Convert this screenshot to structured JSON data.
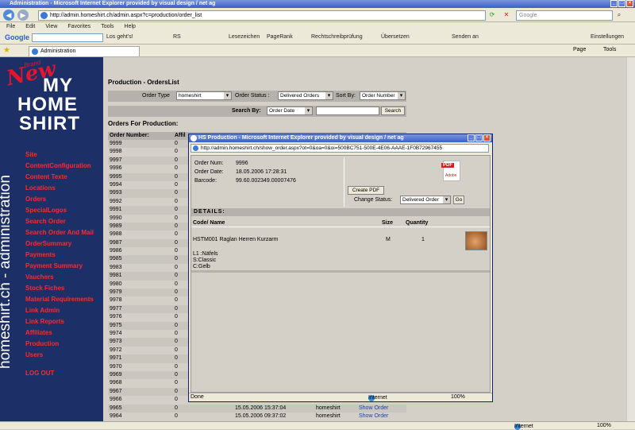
{
  "window": {
    "title": "Administration - Microsoft Internet Explorer provided by visual design / net ag",
    "address": "http://admin.homeshirt.ch/admin.aspx?c=production/order_list",
    "search_placeholder": "Google"
  },
  "menu": [
    "File",
    "Edit",
    "View",
    "Favorites",
    "Tools",
    "Help"
  ],
  "googlebar": {
    "logo": "Google",
    "items": [
      "Los geht's!",
      "RS",
      "Lesezeichen",
      "PageRank",
      "Rechtschreibprüfung",
      "Übersetzen",
      "Senden an",
      "Einstellungen"
    ]
  },
  "tabs": {
    "active": "Administration",
    "right_items": [
      "Page",
      "Tools"
    ]
  },
  "sidebar": {
    "logo_brand": "Brand",
    "logo_new": "New",
    "logo_my": "MY",
    "logo_home": "HOME",
    "logo_shirt": "SHIRT",
    "vertical": "homeshirt.ch - administration",
    "items": [
      "Site",
      "ContentConfiguration",
      "Content Texte",
      "Locations",
      "Orders",
      "SpecialLogos",
      "Search Order",
      "Search Order And Mail",
      "OrderSummary",
      "Payments",
      "Payment Summary",
      "Vauchers",
      "Stock Fiches",
      "Material Requirements",
      "Link Admin",
      "Link Reports",
      "Affiliates",
      "Production",
      "Users"
    ],
    "logout": "LOG OUT"
  },
  "page": {
    "title": "Production - OrdersList",
    "order_type_label": "Order Type",
    "order_type_value": "homeshirt",
    "order_status_label": "Order Status :",
    "order_status_value": "Delivered Orders",
    "sort_by_label": "Sort By:",
    "sort_by_value": "Order Number",
    "search_by_label": "Search By:",
    "search_by_value": "Order Date",
    "search_button": "Search",
    "orders_heading": "Orders For Production:",
    "col_order_number": "Order Number:",
    "col_affi": "Affil",
    "orders": [
      {
        "num": "9999",
        "affi": "0"
      },
      {
        "num": "9998",
        "affi": "0"
      },
      {
        "num": "9997",
        "affi": "0"
      },
      {
        "num": "9996",
        "affi": "0"
      },
      {
        "num": "9995",
        "affi": "0"
      },
      {
        "num": "9994",
        "affi": "0"
      },
      {
        "num": "9993",
        "affi": "0"
      },
      {
        "num": "9992",
        "affi": "0"
      },
      {
        "num": "9991",
        "affi": "0"
      },
      {
        "num": "9990",
        "affi": "0"
      },
      {
        "num": "9989",
        "affi": "0"
      },
      {
        "num": "9988",
        "affi": "0"
      },
      {
        "num": "9987",
        "affi": "0"
      },
      {
        "num": "9986",
        "affi": "0"
      },
      {
        "num": "9985",
        "affi": "0"
      },
      {
        "num": "9983",
        "affi": "0"
      },
      {
        "num": "9981",
        "affi": "0"
      },
      {
        "num": "9980",
        "affi": "0"
      },
      {
        "num": "9979",
        "affi": "0"
      },
      {
        "num": "9978",
        "affi": "0"
      },
      {
        "num": "9977",
        "affi": "0"
      },
      {
        "num": "9976",
        "affi": "0"
      },
      {
        "num": "9975",
        "affi": "0"
      },
      {
        "num": "9974",
        "affi": "0"
      },
      {
        "num": "9973",
        "affi": "0"
      },
      {
        "num": "9972",
        "affi": "0"
      },
      {
        "num": "9971",
        "affi": "0"
      },
      {
        "num": "9970",
        "affi": "0"
      },
      {
        "num": "9969",
        "affi": "0"
      },
      {
        "num": "9968",
        "affi": "0"
      },
      {
        "num": "9967",
        "affi": "0"
      },
      {
        "num": "9966",
        "affi": "0"
      }
    ],
    "visible_rows": [
      {
        "num": "9965",
        "affi": "0",
        "date": "15.05.2006 15:37:04",
        "type": "homeshirt",
        "action": "Show Order"
      },
      {
        "num": "9964",
        "affi": "0",
        "date": "15.05.2006 09:37:02",
        "type": "homeshirt",
        "action": "Show Order"
      }
    ]
  },
  "popup": {
    "title": "HS Production - Microsoft Internet Explorer provided by visual design / net ag",
    "address": "http://admin.homeshirt.ch/show_order.aspx?ot=0&oa=0&oi=500BC751-500E-4E06-AAAE-1F0B72967455",
    "order_num_label": "Order Num:",
    "order_num": "9996",
    "order_date_label": "Order Date:",
    "order_date": "18.05.2006 17:28:31",
    "barcode_label": "Barcode:",
    "barcode": "99.60.002349.00007476",
    "pdf_label": "PDF",
    "pdf_sub": "Adobe",
    "create_pdf": "Create PDF",
    "change_status_label": "Change Status:",
    "change_status_value": "Delivered Order",
    "go_button": "Go",
    "details_label": "DETAILS:",
    "col_code": "Code/ Name",
    "col_size": "Size",
    "col_qty": "Quantity",
    "item_code": "HSTM001 Raglan Herren Kurzarm",
    "item_size": "M",
    "item_qty": "1",
    "item_line1": "L1 :Näfels",
    "item_line2": "S:Classic",
    "item_line3": "C:Gelb",
    "status_done": "Done",
    "status_zone": "Internet",
    "status_zoom": "100%"
  },
  "statusbar": {
    "zone": "Internet",
    "zoom": "100%"
  }
}
